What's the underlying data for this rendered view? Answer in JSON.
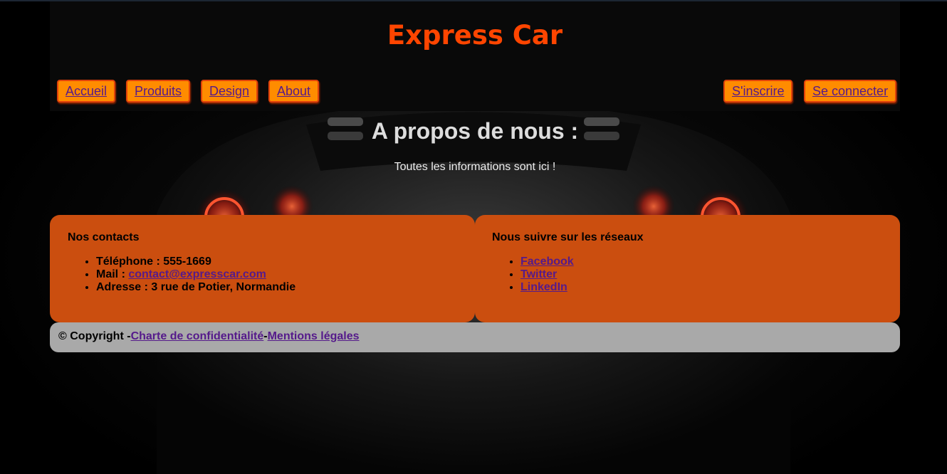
{
  "header": {
    "brand": "Express Car"
  },
  "nav": {
    "left": [
      "Accueil",
      "Produits",
      "Design",
      "About"
    ],
    "right": [
      "S'inscrire",
      "Se connecter"
    ]
  },
  "about": {
    "title": "A propos de nous :",
    "subtitle": "Toutes les informations sont ici !"
  },
  "contacts": {
    "heading": "Nos contacts",
    "phone_label": "Téléphone : 555-1669",
    "mail_label": "Mail : ",
    "mail_link": "contact@expresscar.com",
    "address": "Adresse : 3 rue de Potier, Normandie"
  },
  "social": {
    "heading": "Nous suivre sur les réseaux",
    "links": [
      "Facebook",
      "Twitter",
      "LinkedIn"
    ]
  },
  "footer": {
    "copyright": "© Copyright -",
    "privacy": "Charte de confidentialité",
    "sep": "-",
    "legal": "Mentions légales"
  },
  "colors": {
    "brand": "#ff4500",
    "nav_button": "#ff8c00",
    "panel": "#cb4e0f",
    "footer": "#a9a9a9",
    "link": "#551a8b"
  }
}
